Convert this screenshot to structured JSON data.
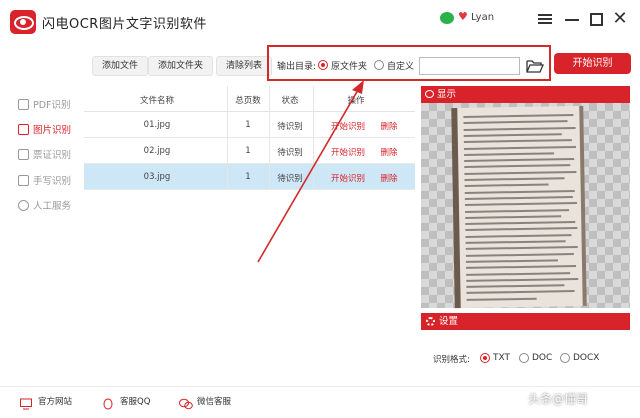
{
  "app": {
    "title": "闪电OCR图片文字识别软件",
    "user": "Lyan",
    "heart": "♥",
    "close_glyph": "✕"
  },
  "toolbar": {
    "add_file": "添加文件",
    "add_folder": "添加文件夹",
    "clear_list": "清除列表",
    "output_label": "输出目录:",
    "opt_source": "原文件夹",
    "opt_custom": "自定义",
    "path_value": "",
    "start": "开始识别"
  },
  "sidebar": {
    "items": [
      {
        "label": "PDF识别",
        "icon": "pdf-icon"
      },
      {
        "label": "图片识别",
        "icon": "image-icon"
      },
      {
        "label": "票证识别",
        "icon": "card-icon"
      },
      {
        "label": "手写识别",
        "icon": "handwriting-icon"
      },
      {
        "label": "人工服务",
        "icon": "smile-icon"
      }
    ]
  },
  "table": {
    "headers": [
      "文件名称",
      "总页数",
      "状态",
      "操作"
    ],
    "rows": [
      {
        "name": "01.jpg",
        "pages": "1",
        "status": "待识别",
        "action": "开始识别",
        "delete": "删除"
      },
      {
        "name": "02.jpg",
        "pages": "1",
        "status": "待识别",
        "action": "开始识别",
        "delete": "删除"
      },
      {
        "name": "03.jpg",
        "pages": "1",
        "status": "待识别",
        "action": "开始识别",
        "delete": "删除"
      }
    ]
  },
  "preview": {
    "title": "显示"
  },
  "settings": {
    "title": "设置",
    "format_label": "识别格式:",
    "formats": [
      "TXT",
      "DOC",
      "DOCX"
    ],
    "selected": "TXT"
  },
  "footer": {
    "site": "官方网站",
    "qq": "客服QQ",
    "wechat": "微信客服",
    "watermark": "头条@懂哥"
  },
  "colors": {
    "accent": "#d8232a",
    "selected_row": "#cde7f7"
  }
}
